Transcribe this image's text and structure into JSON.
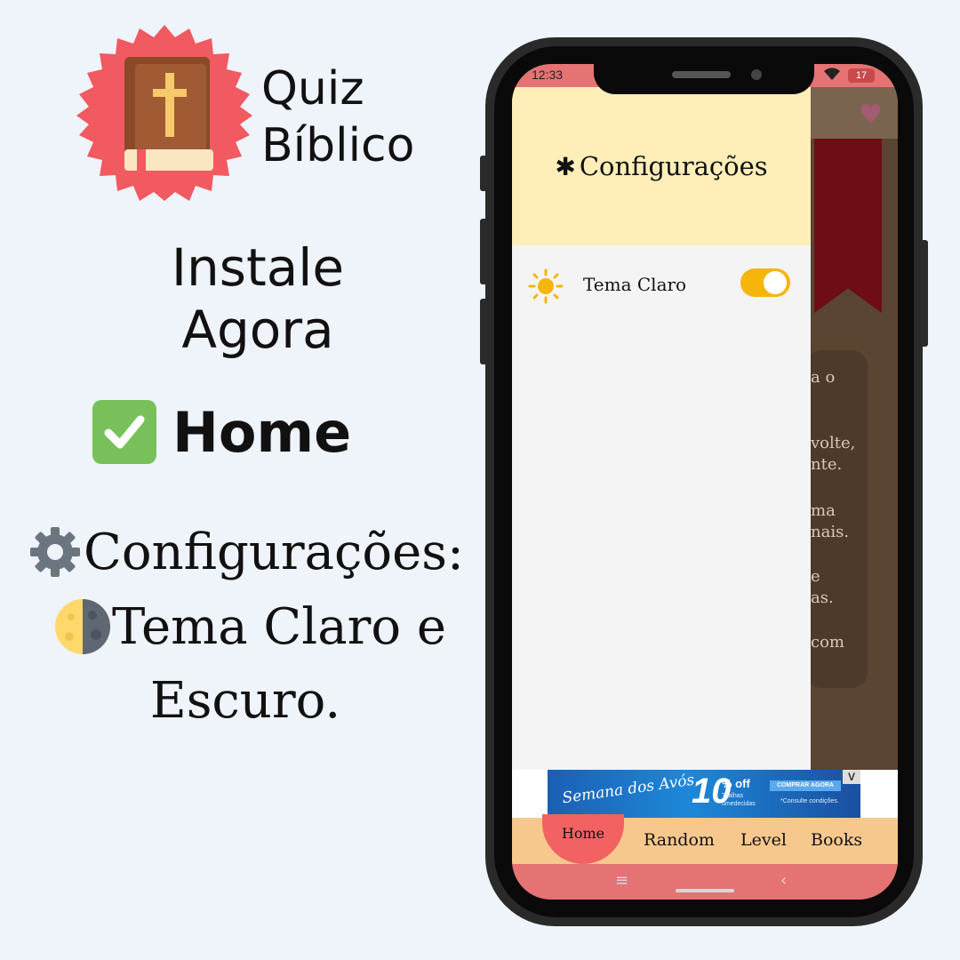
{
  "promo": {
    "logo_line1": "Quiz",
    "logo_line2": "Bíblico",
    "install_line1": "Instale",
    "install_line2": "Agora",
    "home_label": "Home",
    "config_label": "Configurações:",
    "theme_line": "Tema Claro e",
    "theme_line2": "Escuro."
  },
  "status_bar": {
    "time": "12:33",
    "battery": "17"
  },
  "drawer": {
    "title": "Configurações",
    "setting_label": "Tema Claro",
    "toggle_on": true
  },
  "background_text": [
    "a o",
    "volte,",
    "nte.",
    "ma",
    "nais.",
    "e",
    "as.",
    "com"
  ],
  "ad": {
    "script": "Semana dos Avós",
    "number": "10",
    "off": "% off",
    "sub1": "Toalhas",
    "sub2": "umedecidas",
    "button": "COMPRAR AGORA",
    "note": "*Consulte condições.",
    "close": "V"
  },
  "bottom_nav": {
    "home": "Home",
    "random": "Random",
    "level": "Level",
    "books": "Books"
  },
  "colors": {
    "bg": "#eff3fa",
    "drawer_header": "#ffeeb8",
    "toggle": "#f5b50a",
    "nav": "#f7c88e",
    "nav_active": "#f26262",
    "status": "#e57373"
  }
}
